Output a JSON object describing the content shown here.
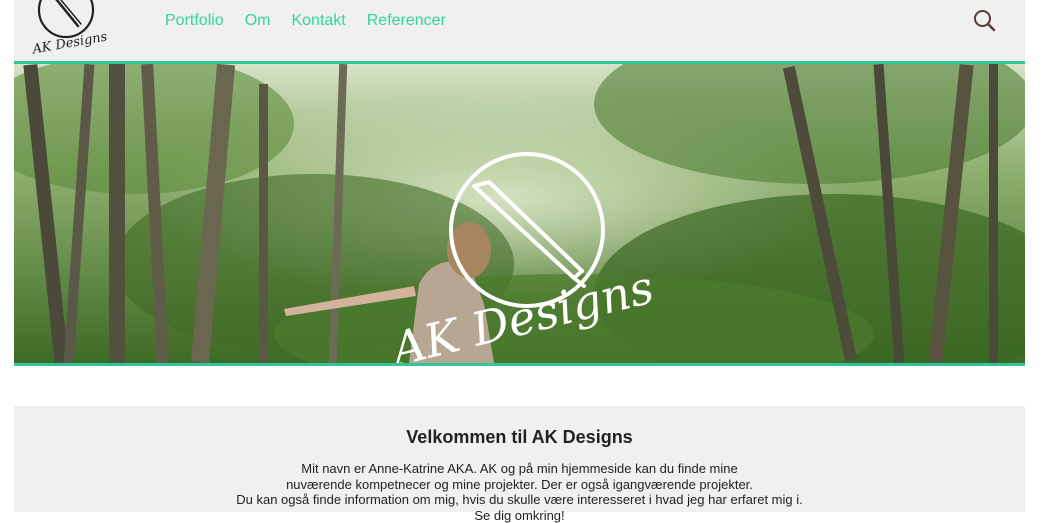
{
  "header": {
    "logo_text": "AK Designs",
    "nav": [
      {
        "label": "Portfolio"
      },
      {
        "label": "Om"
      },
      {
        "label": "Kontakt"
      },
      {
        "label": "Referencer"
      }
    ],
    "search_icon": "search-icon"
  },
  "hero": {
    "logo_text": "AK Designs",
    "image": "forest-woman-photo"
  },
  "welcome": {
    "title": "Velkommen til AK Designs",
    "lines": [
      "Mit navn er Anne-Katrine AKA. AK og på min hjemmeside kan du finde mine",
      "nuværende kompetnecer og mine projekter. Der er også igangværende projekter.",
      "Du kan også finde information om mig, hvis du skulle være interesseret i hvad jeg har erfaret mig i.",
      "Se dig omkring!"
    ]
  },
  "colors": {
    "accent": "#2fc79a",
    "nav_text": "#33d49e",
    "header_bg": "#f0f0f0"
  }
}
